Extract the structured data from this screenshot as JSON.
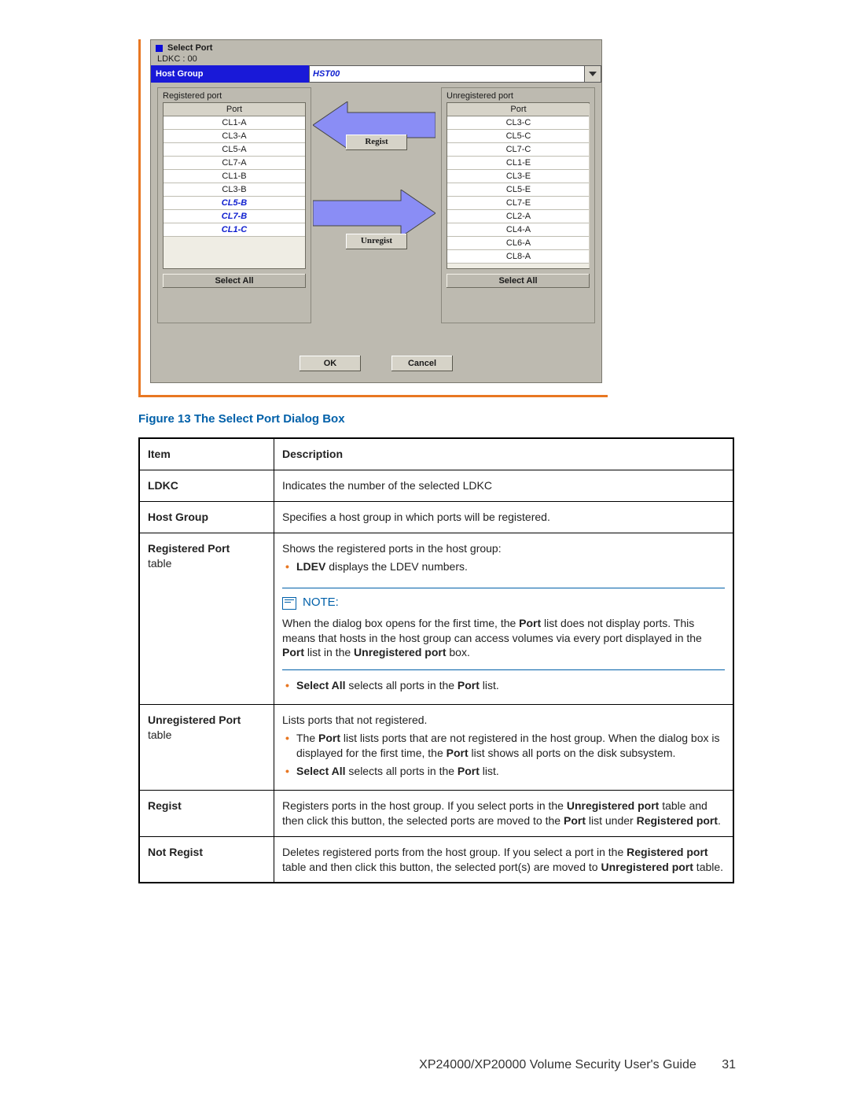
{
  "dialog": {
    "title": "Select Port",
    "ldkc_label": "LDKC : 00",
    "hostgroup_label": "Host Group",
    "hostgroup_value": "HST00",
    "registered": {
      "group_label": "Registered port",
      "header": "Port",
      "rows": [
        "CL1-A",
        "CL3-A",
        "CL5-A",
        "CL7-A",
        "CL1-B",
        "CL3-B"
      ],
      "rows_italic": [
        "CL5-B",
        "CL7-B",
        "CL1-C"
      ],
      "select_all": "Select All"
    },
    "unregistered": {
      "group_label": "Unregistered port",
      "header": "Port",
      "rows": [
        "CL3-C",
        "CL5-C",
        "CL7-C",
        "CL1-E",
        "CL3-E",
        "CL5-E",
        "CL7-E",
        "CL2-A",
        "CL4-A",
        "CL6-A",
        "CL8-A"
      ],
      "select_all": "Select All"
    },
    "regist_btn": "Regist",
    "unregist_btn": "Unregist",
    "ok": "OK",
    "cancel": "Cancel"
  },
  "caption": "Figure 13 The Select Port Dialog Box",
  "table": {
    "h_item": "Item",
    "h_desc": "Description",
    "rows": {
      "ldkc": {
        "k": "LDKC",
        "v": "Indicates the number of the selected LDKC"
      },
      "hostgroup": {
        "k": "Host Group",
        "v": "Specifies a host group in which ports will be registered."
      },
      "registered": {
        "k": "Registered Port",
        "k2": "table",
        "intro": "Shows the registered ports in the host group:",
        "b1a": "LDEV",
        "b1b": " displays the LDEV numbers.",
        "note_hd": "NOTE:",
        "note_body_a": "When the dialog box opens for the first time, the ",
        "note_body_b": "Port",
        "note_body_c": " list does not display ports. This means that hosts in the host group can access volumes via every port displayed in the ",
        "note_body_d": "Port",
        "note_body_e": " list in the ",
        "note_body_f": "Unregistered port",
        "note_body_g": " box.",
        "b2a": "Select All",
        "b2b": " selects all ports in the ",
        "b2c": "Port",
        "b2d": " list."
      },
      "unregistered": {
        "k": "Unregistered Port",
        "k2": "table",
        "intro": "Lists ports that not registered.",
        "b1a": "The ",
        "b1b": "Port",
        "b1c": " list lists ports that are not registered in the host group. When the dialog box is displayed for the first time, the ",
        "b1d": "Port",
        "b1e": " list shows all ports on the disk subsystem.",
        "b2a": "Select All",
        "b2b": " selects all ports in the ",
        "b2c": "Port",
        "b2d": " list."
      },
      "regist": {
        "k": "Regist",
        "a": "Registers ports in the host group. If you select ports in the ",
        "b": "Unregistered port",
        "c": " table and then click this button, the selected ports are moved to the ",
        "d": "Port",
        "e": " list under ",
        "f": "Registered port",
        "g": "."
      },
      "notregist": {
        "k": "Not Regist",
        "a": "Deletes registered ports from the host group. If you select a port in the ",
        "b": "Registered port",
        "c": " table and then click this button, the selected port(s) are moved to ",
        "d": "Unregistered port",
        "e": " table."
      }
    }
  },
  "footer": {
    "title": "XP24000/XP20000 Volume Security User's Guide",
    "page": "31"
  }
}
